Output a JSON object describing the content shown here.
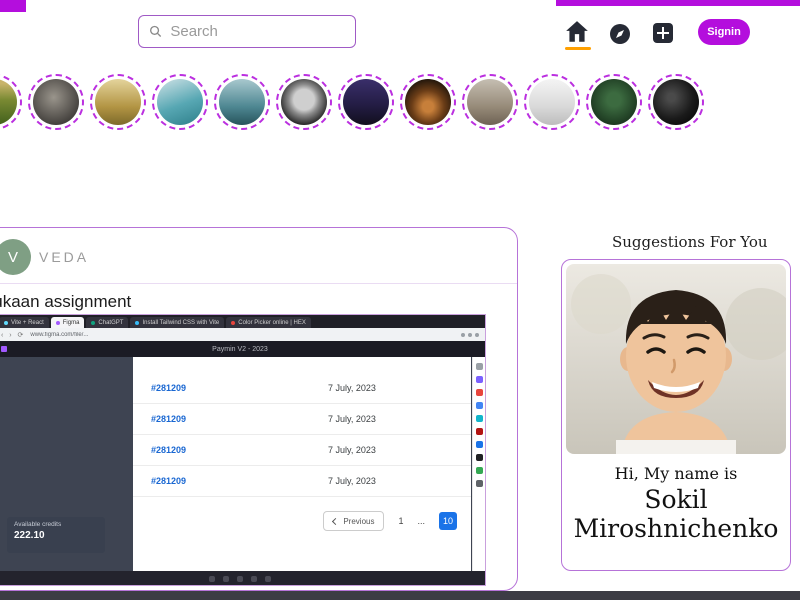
{
  "theme": {
    "accent_magenta": "#b40edd",
    "story_ring": "#bb2fe0",
    "card_border": "#b673d8",
    "link_blue": "#1967d2",
    "active_page_blue": "#1a73e8",
    "home_underline_orange": "#ffa000"
  },
  "header": {
    "search_placeholder": "Search",
    "signin_label": "Signin"
  },
  "stories": {
    "items": [
      {
        "name": "sunset-field"
      },
      {
        "name": "rocks"
      },
      {
        "name": "wheat"
      },
      {
        "name": "laboratory"
      },
      {
        "name": "mountain-lake"
      },
      {
        "name": "moon"
      },
      {
        "name": "night-sky"
      },
      {
        "name": "cave-silhouette"
      },
      {
        "name": "dried-flowers"
      },
      {
        "name": "white-bed"
      },
      {
        "name": "dark-forest"
      },
      {
        "name": "dark-abstract"
      }
    ]
  },
  "post": {
    "username": "VEDA",
    "avatar_letter": "V",
    "caption": "Dukaan assignment",
    "screenshot": {
      "browser_tabs": [
        {
          "label": "Vite + React"
        },
        {
          "label": "Figma"
        },
        {
          "label": "ChatGPT"
        },
        {
          "label": "Install Tailwind CSS with Vite"
        },
        {
          "label": "Color Picker online | HEX"
        }
      ],
      "url": "www.figma.com/file/...",
      "figma_title": "Paymin V2 - 2023",
      "table_rows": [
        {
          "id": "#281209",
          "date": "7 July, 2023"
        },
        {
          "id": "#281209",
          "date": "7 July, 2023"
        },
        {
          "id": "#281209",
          "date": "7 July, 2023"
        },
        {
          "id": "#281209",
          "date": "7 July, 2023"
        }
      ],
      "pagination": {
        "previous_label": "Previous",
        "page": "1",
        "ellipsis": "...",
        "active_page": "10"
      },
      "credits": {
        "label": "Available credits",
        "value": "222.10"
      }
    }
  },
  "suggestions": {
    "title": "Suggestions For You",
    "card": {
      "greeting": "Hi, My name is",
      "first_name": "Sokil",
      "last_name": "Miroshnichenko"
    }
  }
}
